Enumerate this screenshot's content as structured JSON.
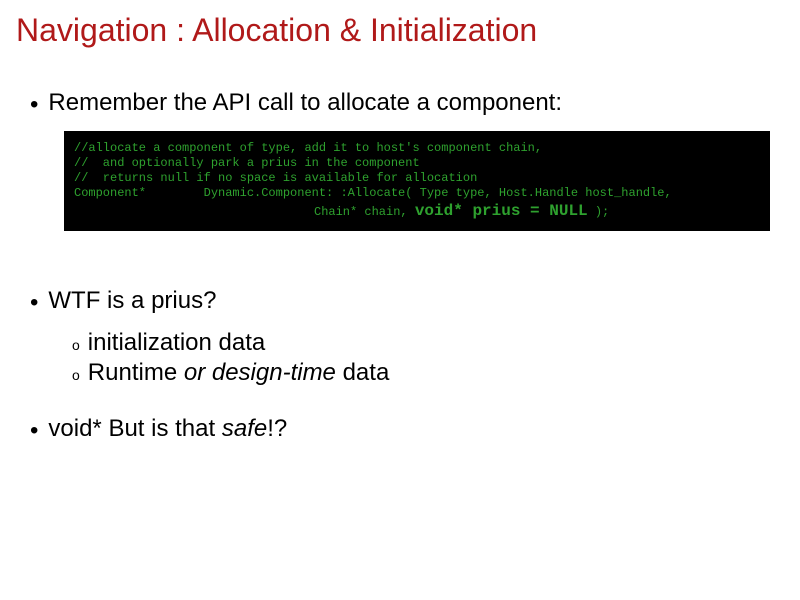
{
  "title": "Navigation : Allocation & Initialization",
  "bullet1": "Remember the API call to allocate a component:",
  "code": {
    "c1": "//allocate a component of type, add it to host's component chain,",
    "c2": "//  and optionally park a prius in the component",
    "c3": "//  returns null if no space is available for allocation",
    "c4": "Component*        Dynamic.Component: :Allocate( Type type, Host.Handle host_handle,",
    "c5a": "Chain* chain, ",
    "c5b": "void* prius = NULL",
    "c5c": " );"
  },
  "bullet2": "WTF is a prius?",
  "sub1": "initialization data",
  "sub2a": "Runtime ",
  "sub2b": "or design-time",
  "sub2c": " data",
  "bullet3a": "void* But is that ",
  "bullet3b": "safe",
  "bullet3c": "!?"
}
